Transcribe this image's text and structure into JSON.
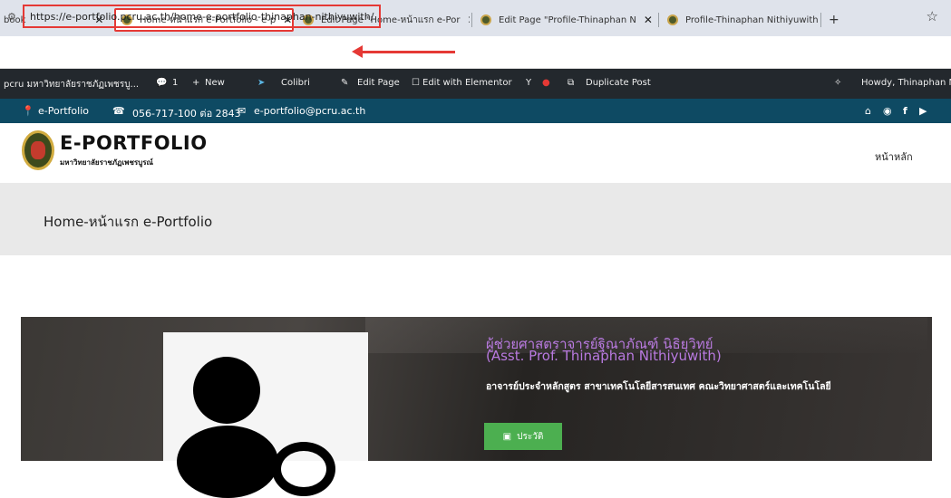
{
  "browser": {
    "tabs": [
      {
        "label": "book"
      },
      {
        "label": "Home-หน้าแรก e-Portfolio - e-p"
      },
      {
        "label": "Edit Page \"Home-หน้าแรก e-Por"
      },
      {
        "label": "Edit Page \"Profile-Thinaphan N"
      },
      {
        "label": "Profile-Thinaphan Nithiyuwith"
      }
    ],
    "close_glyph": "✕",
    "new_tab_glyph": "+",
    "url": "https://e-portfolio.pcru.ac.th/home-e-portfolio-thinaphan-nithiyuwith/",
    "star_glyph": "☆"
  },
  "wp_admin": {
    "site": "pcru มหาวิทยาลัยราชภัฏเพชรบู...",
    "comments_count": "1",
    "new_label": "New",
    "colibri_label": "Colibri",
    "edit_page_label": "Edit Page",
    "edit_elementor_label": "Edit with Elementor",
    "duplicate_label": "Duplicate Post",
    "howdy": "Howdy, Thinaphan N"
  },
  "infobar": {
    "portfolio_label": "e-Portfolio",
    "phone": "056-717-100 ต่อ 2843",
    "email": "e-portfolio@pcru.ac.th"
  },
  "site": {
    "brand": "E-PORTFOLIO",
    "brand_sub": "มหาวิทยาลัยราชภัฏเพชรบูรณ์",
    "nav_home": "หน้าหลัก",
    "page_title": "Home-หน้าแรก e-Portfolio"
  },
  "profile": {
    "name_th": "ผู้ช่วยศาสตราจารย์ฐิณาภัณฑ์ นิธิยุวิทย์",
    "name_en": "(Asst. Prof. Thinaphan Nithiyuwith)",
    "position": "อาจารย์ประจำหลักสูตร สาขาเทคโนโลยีสารสนเทศ คณะวิทยาศาสตร์และเทคโนโลยี",
    "bio_button": "ประวัติ"
  },
  "colors": {
    "highlight": "#e53935",
    "wp_bar": "#23282d",
    "info_bar": "#0e4a63",
    "name_color": "#b97ae0",
    "button": "#4caf50"
  },
  "icons": [
    "tune-icon",
    "star-icon",
    "location-icon",
    "phone-icon",
    "mail-icon",
    "home-icon",
    "messenger-icon",
    "facebook-icon",
    "video-icon"
  ]
}
